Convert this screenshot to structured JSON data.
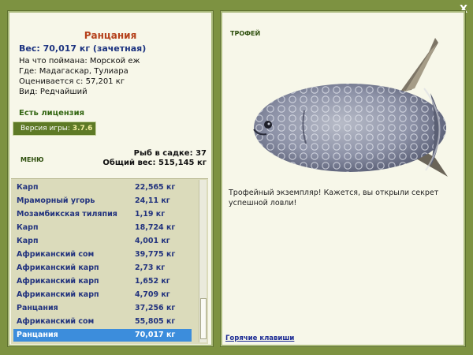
{
  "window": {
    "close_label": "X"
  },
  "catch": {
    "title": "Ранцания",
    "weight_line": "Вес: 70,017 кг (зачетная)",
    "details": [
      "На что поймана: Морской еж",
      "Где: Мадагаскар, Тулиара",
      "Оценивается с: 57,201 кг",
      "Вид: Редчайший"
    ],
    "license": "Есть лицензия",
    "version_label": "Версия игры:",
    "version_value": "3.7.6"
  },
  "menu_label": "МЕНЮ",
  "cage": {
    "count_line": "Рыб в садке: 37",
    "total_line": "Общий вес: 515,145 кг"
  },
  "fish_list": [
    {
      "name": "Карп",
      "weight": "22,565 кг"
    },
    {
      "name": "Мраморный угорь",
      "weight": "24,11 кг"
    },
    {
      "name": "Мозамбикская тиляпия",
      "weight": "1,19 кг"
    },
    {
      "name": "Карп",
      "weight": "18,724 кг"
    },
    {
      "name": "Карп",
      "weight": "4,001 кг"
    },
    {
      "name": "Африканский сом",
      "weight": "39,775 кг"
    },
    {
      "name": "Африканский карп",
      "weight": "2,73 кг"
    },
    {
      "name": "Африканский карп",
      "weight": "1,652 кг"
    },
    {
      "name": "Африканский карп",
      "weight": "4,709 кг"
    },
    {
      "name": "Ранцания",
      "weight": "37,256 кг"
    },
    {
      "name": "Африканский сом",
      "weight": "55,805 кг"
    },
    {
      "name": "Ранцания",
      "weight": "70,017 кг"
    }
  ],
  "selected_index": 11,
  "trophy": {
    "label": "ТРОФЕЙ",
    "description": "Трофейный экземпляр! Кажется, вы открыли секрет успешной ловли!",
    "hotkeys_link": "Горячие клавиши"
  },
  "colors": {
    "frame": "#7d9241",
    "panel": "#f7f7e9",
    "title": "#b5401a",
    "accent_blue": "#22337e",
    "selection": "#3c8ddc"
  }
}
